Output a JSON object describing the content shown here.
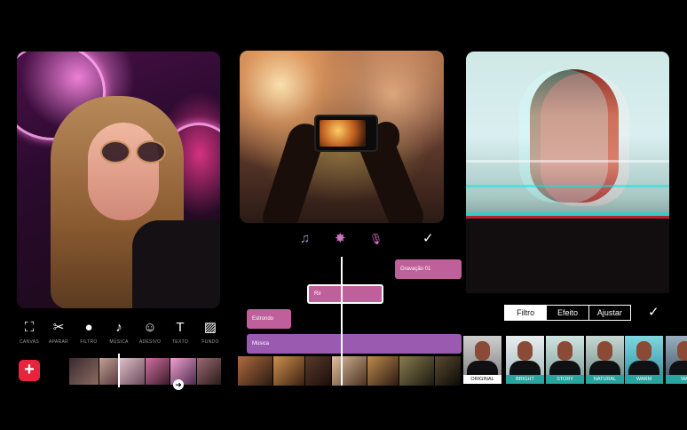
{
  "panel_edit": {
    "tools": [
      {
        "label": "CANVAS",
        "icon": "canvas-icon",
        "glyph": "⛶"
      },
      {
        "label": "APARAR",
        "icon": "scissors-icon",
        "glyph": "✂"
      },
      {
        "label": "FILTRO",
        "icon": "filter-icon",
        "glyph": "●"
      },
      {
        "label": "MÚSICA",
        "icon": "music-note-icon",
        "glyph": "♪"
      },
      {
        "label": "ADESIVO",
        "icon": "sticker-icon",
        "glyph": "☺"
      },
      {
        "label": "TEXTO",
        "icon": "text-icon",
        "glyph": "T"
      },
      {
        "label": "FUNDO",
        "icon": "background-icon",
        "glyph": "▨"
      }
    ],
    "add_glyph": "+",
    "scroll_glyph": "➜",
    "add_button_color": "#e8243c"
  },
  "panel_audio": {
    "actions": [
      {
        "icon": "add-music-icon",
        "glyph": "♫"
      },
      {
        "icon": "effect-burst-icon",
        "glyph": "✸"
      },
      {
        "icon": "microphone-icon",
        "glyph": "🎙"
      },
      {
        "icon": "confirm-check-icon",
        "glyph": "✓"
      }
    ],
    "tracks": {
      "gravacao": "Gravação 01",
      "rir": "Rir",
      "estrondo": "Estrondo",
      "musica": "Música"
    },
    "track_colors": {
      "pink": "#c0609a",
      "purple": "#9a5ab0"
    }
  },
  "panel_filter": {
    "tabs": [
      "Filtro",
      "Efeito",
      "Ajustar"
    ],
    "active_tab": "Filtro",
    "confirm_glyph": "✓",
    "filters": [
      {
        "name": "ORIGINAL",
        "selected": false
      },
      {
        "name": "BRIGHT",
        "selected": false
      },
      {
        "name": "STORY",
        "selected": false
      },
      {
        "name": "NATURAL",
        "selected": false
      },
      {
        "name": "WARM",
        "selected": true
      },
      {
        "name": "WA",
        "selected": false
      }
    ],
    "accent_color": "#2aa49e"
  }
}
